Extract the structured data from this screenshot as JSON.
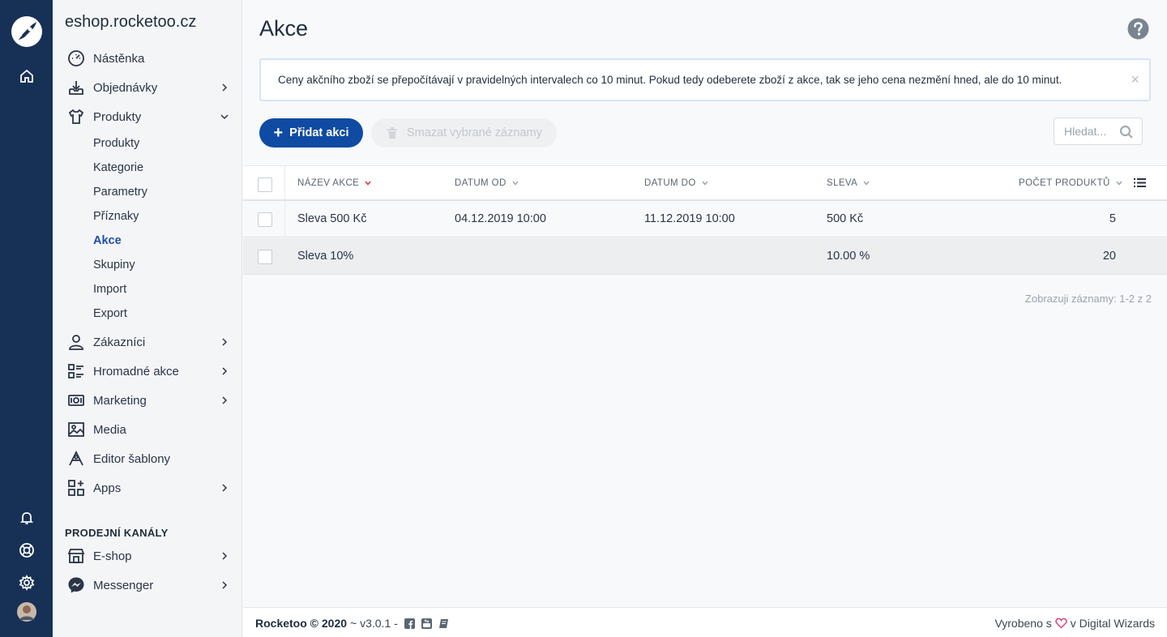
{
  "shop": {
    "name": "eshop.rocketoo.cz"
  },
  "sidebar": {
    "items": [
      {
        "label": "Nástěnka"
      },
      {
        "label": "Objednávky"
      },
      {
        "label": "Produkty"
      },
      {
        "label": "Zákazníci"
      },
      {
        "label": "Hromadné akce"
      },
      {
        "label": "Marketing"
      },
      {
        "label": "Media"
      },
      {
        "label": "Editor šablony"
      },
      {
        "label": "Apps"
      }
    ],
    "subitems": [
      "Produkty",
      "Kategorie",
      "Parametry",
      "Příznaky",
      "Akce",
      "Skupiny",
      "Import",
      "Export"
    ],
    "active_subitem": "Akce",
    "channels_heading": "PRODEJNÍ KANÁLY",
    "channels": [
      {
        "label": "E-shop"
      },
      {
        "label": "Messenger"
      }
    ]
  },
  "page": {
    "title": "Akce",
    "alert": "Ceny akčního zboží se přepočítávají v pravidelných intervalech co 10 minut. Pokud tedy odeberete zboží z akce, tak se jeho cena nezmění hned, ale do 10 minut.",
    "alert_close": "×",
    "add_button": "Přidat akci",
    "delete_button": "Smazat vybrané záznamy",
    "search_placeholder": "Hledat..."
  },
  "table": {
    "columns": [
      "NÁZEV AKCE",
      "DATUM OD",
      "DATUM DO",
      "SLEVA",
      "POČET PRODUKTŮ"
    ],
    "rows": [
      {
        "name": "Sleva 500 Kč",
        "from": "04.12.2019 10:00",
        "to": "11.12.2019 10:00",
        "discount": "500 Kč",
        "count": "5"
      },
      {
        "name": "Sleva 10%",
        "from": "",
        "to": "",
        "discount": "10.00 %",
        "count": "20"
      }
    ],
    "pager_info": "Zobrazuji záznamy: 1-2 z 2"
  },
  "footer": {
    "brand": "Rocketoo © 2020",
    "version": "~ v3.0.1 -",
    "made_prefix": "Vyrobeno s",
    "made_suffix": "v Digital Wizards"
  },
  "colors": {
    "rail": "#173056",
    "primary": "#0f4aa3",
    "active_link": "#1d4ea8",
    "sort_active": "#d9363e",
    "heart": "#e0407b"
  },
  "icons": {
    "rail": [
      "rocket-logo-icon",
      "home-icon",
      "bell-icon",
      "support-icon",
      "gear-icon",
      "user-avatar"
    ],
    "nav": [
      "dashboard-icon",
      "inbox-download-icon",
      "shirt-icon",
      "user-icon",
      "checklist-icon",
      "money-icon",
      "image-icon",
      "drawing-icon",
      "apps-icon",
      "store-icon",
      "messenger-icon"
    ]
  }
}
